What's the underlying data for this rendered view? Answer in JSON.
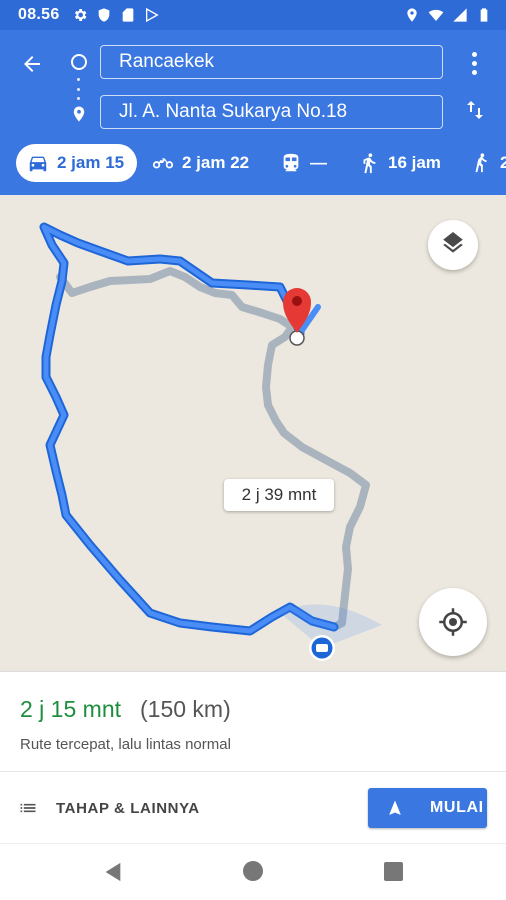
{
  "status_bar": {
    "time": "08.56",
    "left_icons": [
      "gear-icon",
      "shield-icon",
      "sd-card-icon",
      "play-store-icon"
    ],
    "right_icons": [
      "location-icon",
      "wifi-icon",
      "signal-icon",
      "battery-icon"
    ]
  },
  "header": {
    "origin_value": "Rancaekek",
    "destination_value": "Jl. A. Nanta Sukarya No.18",
    "back_icon": "arrow-left-icon",
    "more_icon": "more-vert-icon",
    "swap_icon": "swap-vert-icon"
  },
  "travel_modes": [
    {
      "icon": "car-icon",
      "label": "2 jam 15",
      "selected": true
    },
    {
      "icon": "motorcycle-icon",
      "label": "2 jam 22",
      "selected": false
    },
    {
      "icon": "transit-icon",
      "label": "—",
      "selected": false
    },
    {
      "icon": "walk-icon",
      "label": "16 jam",
      "selected": false
    },
    {
      "icon": "ride-icon",
      "label": "2",
      "selected": false
    }
  ],
  "map": {
    "alternate_route_label": "2 j 39 mnt",
    "primary_route_color": "#4285f4",
    "alternate_route_color": "#aab4be",
    "destination_pin_color": "#e53935",
    "layers_icon": "layers-icon",
    "locate_icon": "my-location-icon"
  },
  "summary": {
    "duration": "2 j 15 mnt",
    "distance": "(150 km)",
    "description": "Rute tercepat, lalu lintas normal"
  },
  "actions": {
    "steps_label": "TAHAP & LAINNYA",
    "start_label": "MULAI"
  },
  "colors": {
    "header_blue": "#3a77e0",
    "status_blue": "#2f6bd6",
    "duration_green": "#1e8e3e"
  }
}
